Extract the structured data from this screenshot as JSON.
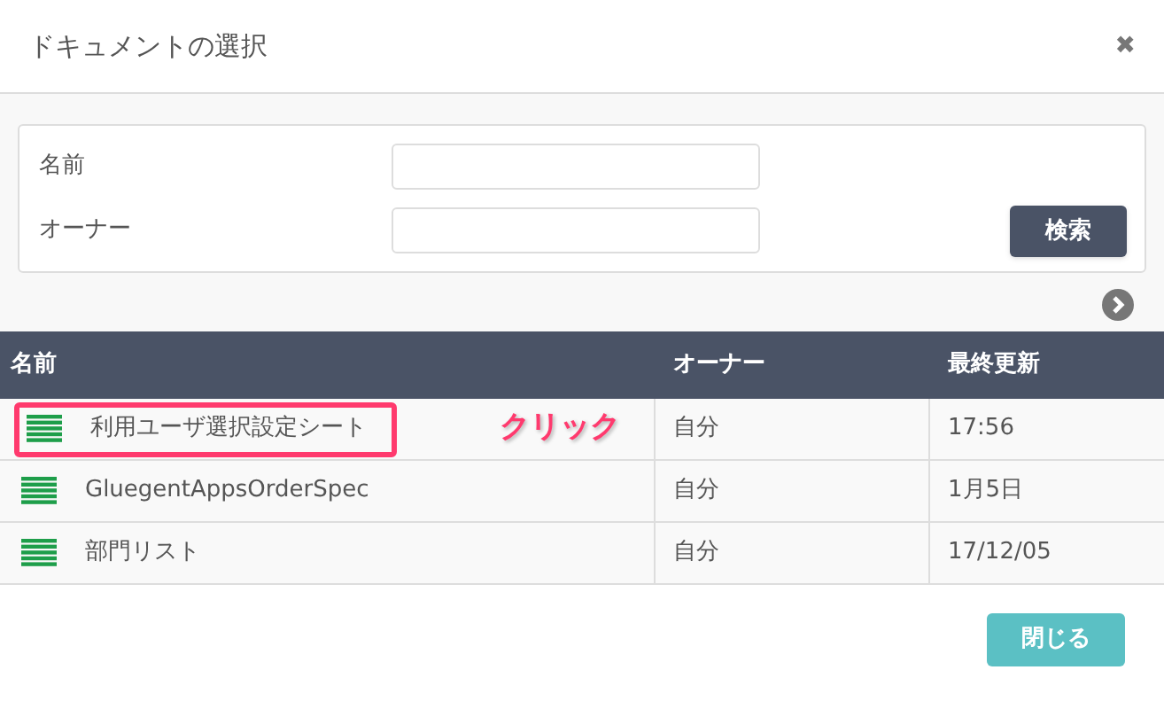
{
  "dialog": {
    "title": "ドキュメントの選択",
    "close_icon": "✖"
  },
  "search_form": {
    "fields": [
      {
        "label": "名前"
      },
      {
        "label": "オーナー"
      }
    ],
    "button": "検索"
  },
  "table": {
    "columns": [
      "名前",
      "オーナー",
      "最終更新"
    ],
    "rows": [
      {
        "name": "利用ユーザ選択設定シート",
        "owner": "自分",
        "updated": "17:56",
        "highlighted": true
      },
      {
        "name": "GluegentAppsOrderSpec",
        "owner": "自分",
        "updated": "1月5日",
        "highlighted": false
      },
      {
        "name": "部門リスト",
        "owner": "自分",
        "updated": "17/12/05",
        "highlighted": false
      }
    ]
  },
  "annotation": {
    "text": "クリック"
  },
  "footer": {
    "button": "閉じる"
  }
}
